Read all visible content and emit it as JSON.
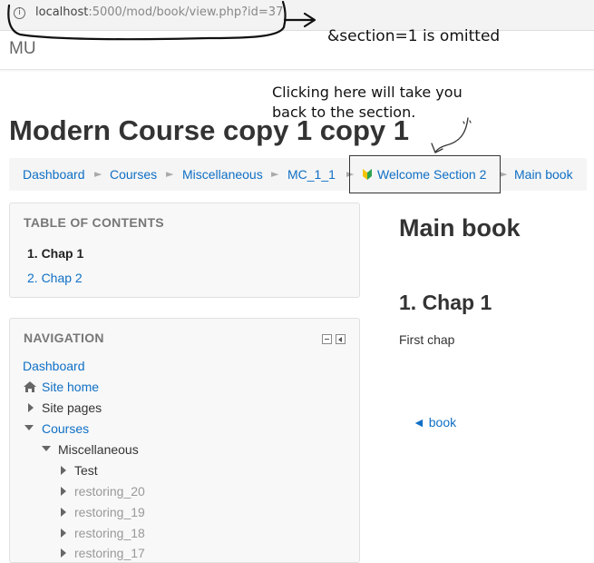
{
  "browser": {
    "url_host": "localhost",
    "url_rest": ":5000/mod/book/view.php?id=37",
    "info_symbol": "i"
  },
  "site": {
    "brand": "MU"
  },
  "annotations": {
    "omitted_note": "&section=1 is omitted",
    "click_note_line1": "Clicking here will take you",
    "click_note_line2": "back to the section."
  },
  "page": {
    "title": "Modern Course copy 1 copy 1"
  },
  "breadcrumb": {
    "separator": "►",
    "items": [
      {
        "label": "Dashboard"
      },
      {
        "label": "Courses"
      },
      {
        "label": "Miscellaneous"
      },
      {
        "label": "MC_1_1"
      },
      {
        "label": "Welcome Section 2",
        "icon": "beginner-leaf-icon"
      },
      {
        "label": "Main book"
      }
    ]
  },
  "toc": {
    "title": "TABLE OF CONTENTS",
    "items": [
      {
        "label": "1. Chap 1",
        "active": true
      },
      {
        "label": "2. Chap 2",
        "active": false
      }
    ]
  },
  "navigation": {
    "title": "NAVIGATION",
    "items": [
      {
        "label": "Dashboard"
      },
      {
        "label": "Site home",
        "icon": "home-icon"
      },
      {
        "label": "Site pages"
      },
      {
        "label": "Courses"
      },
      {
        "label": "Miscellaneous"
      },
      {
        "label": "Test"
      },
      {
        "label": "restoring_20"
      },
      {
        "label": "restoring_19"
      },
      {
        "label": "restoring_18"
      },
      {
        "label": "restoring_17"
      }
    ]
  },
  "main": {
    "book_title": "Main book",
    "chapter_title": "1. Chap 1",
    "chapter_text": "First chap",
    "back_link": "◄ book"
  },
  "colors": {
    "link": "#0f6fc5",
    "breadcrumb_bg": "#f5f5f5",
    "block_bg": "#f8f8f8"
  }
}
